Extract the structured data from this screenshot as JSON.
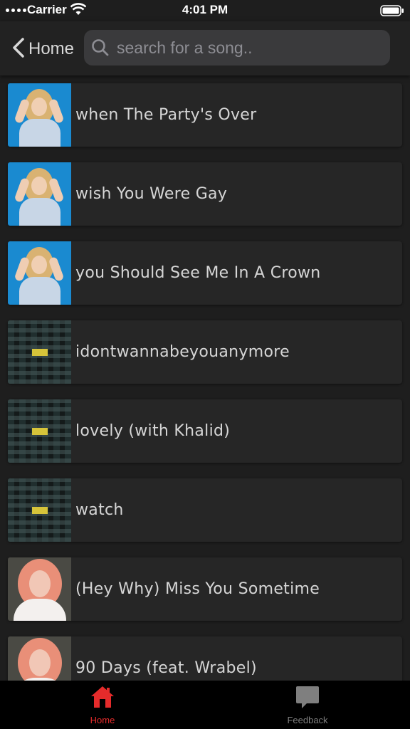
{
  "status_bar": {
    "carrier": "Carrier",
    "time": "4:01 PM"
  },
  "nav": {
    "back_label": "Home",
    "search_placeholder": "search for a song.."
  },
  "songs": [
    {
      "title": "when The Party's Over",
      "art": "blue"
    },
    {
      "title": "wish You Were Gay",
      "art": "blue"
    },
    {
      "title": "you Should See Me In A Crown",
      "art": "blue"
    },
    {
      "title": "idontwannabeyouanymore",
      "art": "dark"
    },
    {
      "title": "lovely (with Khalid)",
      "art": "dark"
    },
    {
      "title": "watch",
      "art": "dark"
    },
    {
      "title": "(Hey Why) Miss You Sometime",
      "art": "pink"
    },
    {
      "title": "90 Days (feat. Wrabel)",
      "art": "pink"
    }
  ],
  "tabs": [
    {
      "label": "Home",
      "icon": "house-icon",
      "color": "#e52b2b",
      "active": true
    },
    {
      "label": "Feedback",
      "icon": "speech-bubble-icon",
      "color": "#7f7f7f",
      "active": false
    }
  ]
}
